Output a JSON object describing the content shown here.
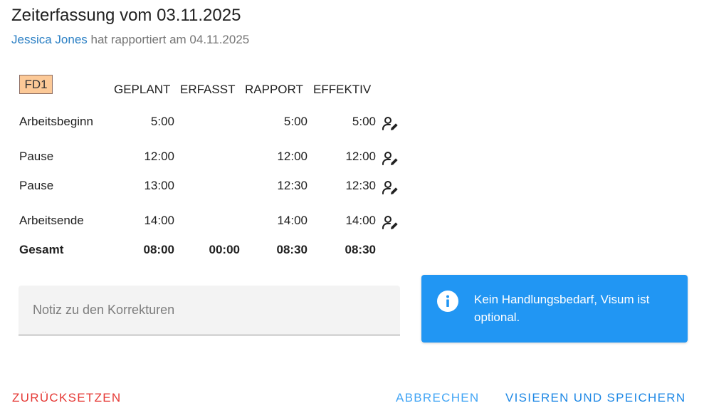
{
  "header": {
    "title": "Zeiterfassung vom 03.11.2025",
    "user_name": "Jessica Jones",
    "reported_text": "hat rapportiert am 04.11.2025"
  },
  "table": {
    "shift_badge": "FD1",
    "columns": [
      "GEPLANT",
      "ERFASST",
      "RAPPORT",
      "EFFEKTIV"
    ],
    "rows": [
      {
        "label": "Arbeitsbeginn",
        "geplant": "5:00",
        "erfasst": "",
        "rapport": "5:00",
        "effektiv": "5:00",
        "edit_icon": "person-edit-icon"
      },
      {
        "label": "Pause",
        "geplant": "12:00",
        "erfasst": "",
        "rapport": "12:00",
        "effektiv": "12:00",
        "edit_icon": "person-edit-icon"
      },
      {
        "label": "Pause",
        "geplant": "13:00",
        "erfasst": "",
        "rapport": "12:30",
        "effektiv": "12:30",
        "edit_icon": "person-edit-icon"
      },
      {
        "label": "Arbeitsende",
        "geplant": "14:00",
        "erfasst": "",
        "rapport": "14:00",
        "effektiv": "14:00",
        "edit_icon": "person-edit-icon"
      }
    ],
    "total": {
      "label": "Gesamt",
      "geplant": "08:00",
      "erfasst": "00:00",
      "rapport": "08:30",
      "effektiv": "08:30"
    }
  },
  "note": {
    "value": "",
    "placeholder": "Notiz zu den Korrekturen"
  },
  "alert": {
    "icon": "info-icon",
    "text": "Kein Handlungsbedarf, Visum ist optional."
  },
  "actions": {
    "reset_label": "ZURÜCKSETZEN",
    "cancel_label": "ABBRECHEN",
    "save_label": "VISIEREN UND SPEICHERN"
  },
  "colors": {
    "link": "#2a7fc4",
    "badge_bg": "#fcc997",
    "alert_bg": "#2196f3",
    "reset": "#e53935",
    "primary": "#1e88e5",
    "cancel": "#42a5f5"
  }
}
